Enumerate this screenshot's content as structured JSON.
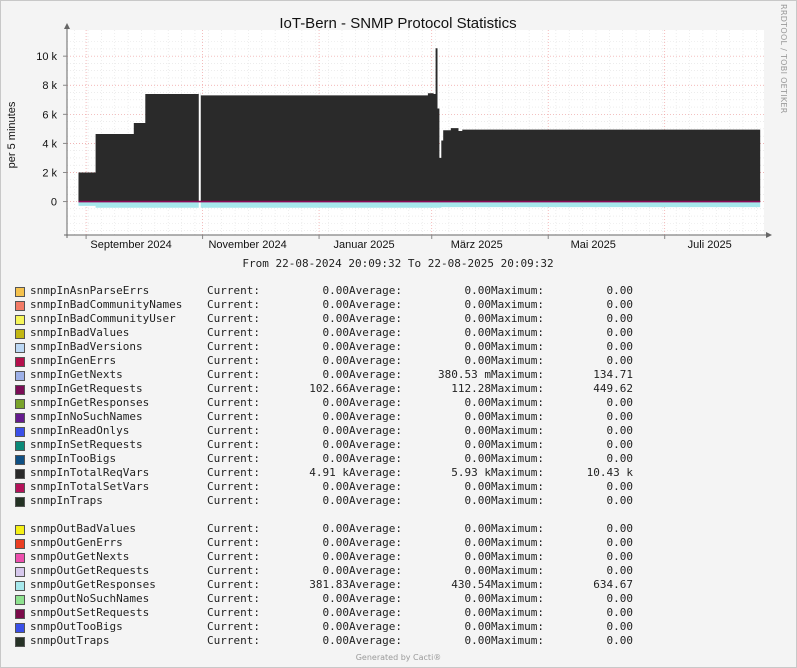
{
  "chart_data": {
    "type": "area",
    "title": "IoT-Bern - SNMP Protocol Statistics",
    "ylabel": "per 5 minutes",
    "xlabel": "",
    "subtitle": "From 22-08-2024 20:09:32 To 22-08-2025 20:09:32",
    "y_ticks": [
      "10 k",
      "8 k",
      "6 k",
      "4 k",
      "2 k",
      "0"
    ],
    "ylim": [
      -2300,
      11800
    ],
    "x_ticks": [
      "September 2024",
      "November 2024",
      "Januar 2025",
      "März 2025",
      "Mai 2025",
      "Juli 2025"
    ],
    "x_tick_dates": [
      "2024-09-01",
      "2024-11-01",
      "2025-01-01",
      "2025-03-01",
      "2025-05-01",
      "2025-07-01"
    ],
    "xlim": [
      "2024-08-22",
      "2025-08-22"
    ],
    "grid": true,
    "colors": {
      "req": "#2a2a2a",
      "resp": "#a6e8ec",
      "gen": "#8b0a55"
    },
    "series": [
      {
        "name": "snmpInTotalReqVars",
        "x": [
          "2024-08-28",
          "2024-09-05",
          "2024-09-06",
          "2024-09-25",
          "2024-09-26",
          "2024-10-01",
          "2024-10-02",
          "2024-10-30",
          "2024-10-31",
          "2025-02-27",
          "2025-03-02",
          "2025-03-03",
          "2025-03-04",
          "2025-03-05",
          "2025-03-06",
          "2025-03-07",
          "2025-03-11",
          "2025-03-15",
          "2025-03-17",
          "2025-08-20"
        ],
        "values": [
          2000,
          2000,
          4650,
          4650,
          5400,
          5400,
          7400,
          7500,
          7300,
          7450,
          7400,
          10550,
          6400,
          3000,
          4200,
          4900,
          5050,
          4850,
          4950,
          4910
        ]
      },
      {
        "name": "snmpOutGetResponses",
        "x": [
          "2024-08-28",
          "2024-09-05",
          "2024-09-06",
          "2025-03-05",
          "2025-03-06",
          "2025-08-20"
        ],
        "values": [
          -300,
          -300,
          -420,
          -420,
          -380,
          -382
        ]
      }
    ]
  },
  "legend_in": [
    {
      "name": "snmpInAsnParseErrs",
      "color": "#f5c24e",
      "current": "0.00",
      "average": "0.00",
      "maximum": "0.00"
    },
    {
      "name": "snmpInBadCommunityNames",
      "color": "#f37b66",
      "current": "0.00",
      "average": "0.00",
      "maximum": "0.00"
    },
    {
      "name": "snnpInBadCommunityUser",
      "color": "#f6f65a",
      "current": "0.00",
      "average": "0.00",
      "maximum": "0.00"
    },
    {
      "name": "snmpInBadValues",
      "color": "#c2b713",
      "current": "0.00",
      "average": "0.00",
      "maximum": "0.00"
    },
    {
      "name": "snmpInBadVersions",
      "color": "#bcd8f4",
      "current": "0.00",
      "average": "0.00",
      "maximum": "0.00"
    },
    {
      "name": "snmpInGenErrs",
      "color": "#b40f4b",
      "current": "0.00",
      "average": "0.00",
      "maximum": "0.00"
    },
    {
      "name": "snmpInGetNexts",
      "color": "#9db0e7",
      "current": "0.00",
      "average": "380.53 m",
      "maximum": "134.71"
    },
    {
      "name": "snmpInGetRequests",
      "color": "#7b0c56",
      "current": "102.66",
      "average": "112.28",
      "maximum": "449.62"
    },
    {
      "name": "snmpInGetResponses",
      "color": "#79a32a",
      "current": "0.00",
      "average": "0.00",
      "maximum": "0.00"
    },
    {
      "name": "snmpInNoSuchNames",
      "color": "#651a8e",
      "current": "0.00",
      "average": "0.00",
      "maximum": "0.00"
    },
    {
      "name": "snmpInReadOnlys",
      "color": "#3a4fe8",
      "current": "0.00",
      "average": "0.00",
      "maximum": "0.00"
    },
    {
      "name": "snmpInSetRequests",
      "color": "#0b8a78",
      "current": "0.00",
      "average": "0.00",
      "maximum": "0.00"
    },
    {
      "name": "snmpInTooBigs",
      "color": "#0e4f83",
      "current": "0.00",
      "average": "0.00",
      "maximum": "0.00"
    },
    {
      "name": "snmpInTotalReqVars",
      "color": "#2a2a2a",
      "current": "4.91 k",
      "average": "5.93 k",
      "maximum": "10.43 k"
    },
    {
      "name": "snmpInTotalSetVars",
      "color": "#b5125a",
      "current": "0.00",
      "average": "0.00",
      "maximum": "0.00"
    },
    {
      "name": "snmpInTraps",
      "color": "#243224",
      "current": "0.00",
      "average": "0.00",
      "maximum": "0.00"
    }
  ],
  "legend_out": [
    {
      "name": "snmpOutBadValues",
      "color": "#f5f016",
      "current": "0.00",
      "average": "0.00",
      "maximum": "0.00"
    },
    {
      "name": "snmpOutGenErrs",
      "color": "#ea3e22",
      "current": "0.00",
      "average": "0.00",
      "maximum": "0.00"
    },
    {
      "name": "snmpOutGetNexts",
      "color": "#ec4fad",
      "current": "0.00",
      "average": "0.00",
      "maximum": "0.00"
    },
    {
      "name": "snmpOutGetRequests",
      "color": "#d6c8ec",
      "current": "0.00",
      "average": "0.00",
      "maximum": "0.00"
    },
    {
      "name": "snmpOutGetResponses",
      "color": "#a6e8ec",
      "current": "381.83",
      "average": "430.54",
      "maximum": "634.67"
    },
    {
      "name": "snmpOutNoSuchNames",
      "color": "#8ee28f",
      "current": "0.00",
      "average": "0.00",
      "maximum": "0.00"
    },
    {
      "name": "snmpOutSetRequests",
      "color": "#7b0a4a",
      "current": "0.00",
      "average": "0.00",
      "maximum": "0.00"
    },
    {
      "name": "snmpOutTooBigs",
      "color": "#3a4fe8",
      "current": "0.00",
      "average": "0.00",
      "maximum": "0.00"
    },
    {
      "name": "snmpOutTraps",
      "color": "#263226",
      "current": "0.00",
      "average": "0.00",
      "maximum": "0.00"
    }
  ],
  "labels": {
    "current": "Current:",
    "average": "Average:",
    "maximum": "Maximum:"
  },
  "footer": "Generated by Cacti®",
  "side_text": "RRDTOOL / TOBI OETIKER"
}
